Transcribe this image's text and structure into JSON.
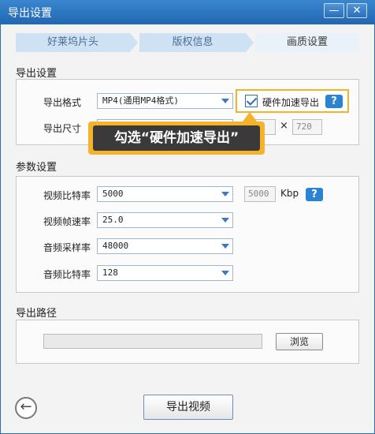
{
  "window": {
    "title": "导出设置",
    "minimize": "—",
    "close": "✕"
  },
  "tabs": [
    {
      "label": "好莱坞片头"
    },
    {
      "label": "版权信息"
    },
    {
      "label": "画质设置"
    }
  ],
  "export_settings": {
    "section_title": "导出设置",
    "format_label": "导出格式",
    "format_value": "MP4(通用MP4格式)",
    "hw_accel_label": "硬件加速导出",
    "hw_accel_checked": true,
    "help": "?",
    "size_label": "导出尺寸",
    "height_value": "720",
    "times": "×"
  },
  "callout": {
    "text": "勾选“硬件加速导出”"
  },
  "params": {
    "section_title": "参数设置",
    "video_bitrate_label": "视频比特率",
    "video_bitrate_value": "5000",
    "bitrate_field": "5000",
    "bitrate_unit": "Kbp",
    "help": "?",
    "fps_label": "视频帧速率",
    "fps_value": "25.0",
    "audio_rate_label": "音频采样率",
    "audio_rate_value": "48000",
    "audio_bitrate_label": "音频比特率",
    "audio_bitrate_value": "128"
  },
  "output": {
    "section_title": "导出路径",
    "path_value": "",
    "browse_label": "浏览"
  },
  "footer": {
    "export_label": "导出视频",
    "back_icon": "←"
  },
  "colors": {
    "titlebar": "#2b6fb7",
    "accent": "#2b83d3",
    "highlight": "#f4b32b",
    "callout_bg": "#3a3a3a"
  }
}
